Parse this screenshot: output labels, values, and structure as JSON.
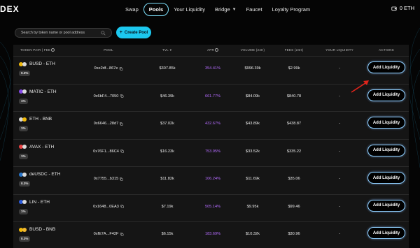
{
  "brand": {
    "logo_text": "DEX"
  },
  "nav": {
    "items": [
      {
        "label": "Swap",
        "active": false
      },
      {
        "label": "Pools",
        "active": true
      },
      {
        "label": "Your Liquidity",
        "active": false
      },
      {
        "label": "Bridge",
        "active": false,
        "has_dropdown": true
      },
      {
        "label": "Faucet",
        "active": false
      },
      {
        "label": "Loyalty Program",
        "active": false
      }
    ],
    "wallet_balance": "0 ETH"
  },
  "toolbar": {
    "search_placeholder": "Search by token name or pool address",
    "create_pool_label": "Create Pool"
  },
  "table": {
    "headers": {
      "pair": "TOKEN PAIR | FEE",
      "pool": "POOL",
      "tvl": "TVL",
      "apr": "APR",
      "volume": "VOLUME (24H)",
      "fees": "FEES (24H)",
      "your_liquidity": "YOUR LIQUIDITY",
      "actions": "ACTIONS"
    },
    "rows": [
      {
        "pair": "BUSD - ETH",
        "fee": "0.3%",
        "pool": "0xe2df...867e",
        "tvl": "$307.85k",
        "apr": "354.41%",
        "volume": "$996.39k",
        "fees": "$2.99k",
        "liquidity": "-",
        "action": "Add Liquidity",
        "coins": [
          "#f0b90b",
          "#d9d9d9"
        ]
      },
      {
        "pair": "MATIC - ETH",
        "fee": "1%",
        "pool": "0x6bF4...7050",
        "tvl": "$46.39k",
        "apr": "661.77%",
        "volume": "$84.09k",
        "fees": "$840.78",
        "liquidity": "-",
        "action": "Add Liquidity",
        "coins": [
          "#8247e5",
          "#d9d9d9"
        ]
      },
      {
        "pair": "ETH - BNB",
        "fee": "1%",
        "pool": "0x6646...28d7",
        "tvl": "$37.02k",
        "apr": "432.67%",
        "volume": "$43.89k",
        "fees": "$438.87",
        "liquidity": "-",
        "action": "Add Liquidity",
        "coins": [
          "#d9d9d9",
          "#f0b90b"
        ]
      },
      {
        "pair": "AVAX - ETH",
        "fee": "1%",
        "pool": "0x76F1...86C4",
        "tvl": "$16.23k",
        "apr": "753.95%",
        "volume": "$33.52k",
        "fees": "$335.22",
        "liquidity": "-",
        "action": "Add Liquidity",
        "coins": [
          "#e84142",
          "#d9d9d9"
        ]
      },
      {
        "pair": "deUSDC - ETH",
        "fee": "0.3%",
        "pool": "0x7755...b315",
        "tvl": "$11.82k",
        "apr": "106.24%",
        "volume": "$11.69k",
        "fees": "$35.06",
        "liquidity": "-",
        "action": "Add Liquidity",
        "coins": [
          "#2775ca",
          "#d9d9d9"
        ]
      },
      {
        "pair": "LIN - ETH",
        "fee": "1%",
        "pool": "0x1648...0EA3",
        "tvl": "$7.19k",
        "apr": "505.14%",
        "volume": "$9.95k",
        "fees": "$99.46",
        "liquidity": "-",
        "action": "Add Liquidity",
        "coins": [
          "#2a5ada",
          "#d9d9d9"
        ]
      },
      {
        "pair": "BUSD - BNB",
        "fee": "0.3%",
        "pool": "0xfE7A...F42F",
        "tvl": "$6.15k",
        "apr": "183.69%",
        "volume": "$10.32k",
        "fees": "$30.96",
        "liquidity": "-",
        "action": "Add Liquidity",
        "coins": [
          "#f0b90b",
          "#f3ba2f"
        ]
      }
    ]
  },
  "colors": {
    "accent": "#1cc8ef",
    "apr": "#b56cff",
    "arrow": "#e0241b"
  }
}
